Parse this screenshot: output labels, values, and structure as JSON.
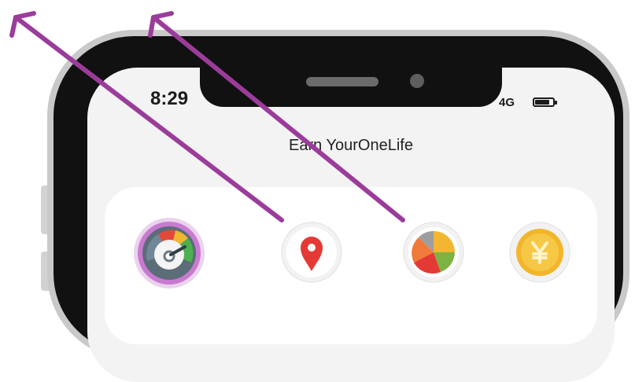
{
  "status_bar": {
    "time": "8:29",
    "network": "4G",
    "battery_level": 0.8
  },
  "app": {
    "title": "Earn YourOneLife"
  },
  "icons": [
    {
      "name": "speedometer-icon"
    },
    {
      "name": "location-pin-icon"
    },
    {
      "name": "pie-chart-icon"
    },
    {
      "name": "yen-coin-icon"
    }
  ],
  "annotations": {
    "arrow_color": "#9b3c9b"
  },
  "colors": {
    "device_bezel": "#111111",
    "screen_background": "#f3f3f3",
    "pin_red": "#e53935",
    "coin_gold": "#f3b52a"
  }
}
